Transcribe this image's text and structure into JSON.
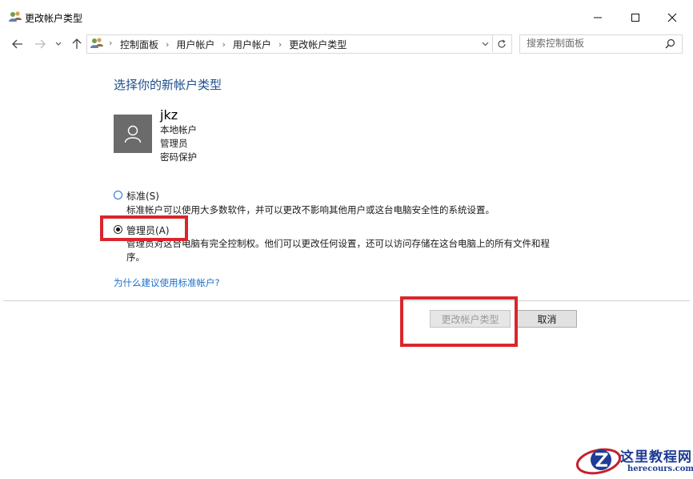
{
  "window": {
    "title": "更改帐户类型"
  },
  "breadcrumb": [
    "控制面板",
    "用户帐户",
    "用户帐户",
    "更改帐户类型"
  ],
  "search": {
    "placeholder": "搜索控制面板"
  },
  "main": {
    "heading": "选择你的新帐户类型",
    "user": {
      "name": "jkz",
      "lines": [
        "本地帐户",
        "管理员",
        "密码保护"
      ]
    },
    "options": [
      {
        "label": "标准(S)",
        "description": [
          "标准帐户可以使用大多数软件，并可以更改不影响其他用户或这台电脑安全性的系统设置。"
        ],
        "selected": false
      },
      {
        "label": "管理员(A)",
        "description": [
          "管理员对这台电脑有完全控制权。他们可以更改任何设置，还可以访问存储在这台电脑上的所有文件和程",
          "序。"
        ],
        "selected": true
      }
    ],
    "why_link": "为什么建议使用标准帐户?"
  },
  "buttons": {
    "change": "更改帐户类型",
    "cancel": "取消"
  },
  "watermark": {
    "title": "这里教程网",
    "url": "herecours.com"
  },
  "colors": {
    "heading": "#1e4e8c",
    "link": "#1e6ec8",
    "highlight": "#d9262c"
  }
}
